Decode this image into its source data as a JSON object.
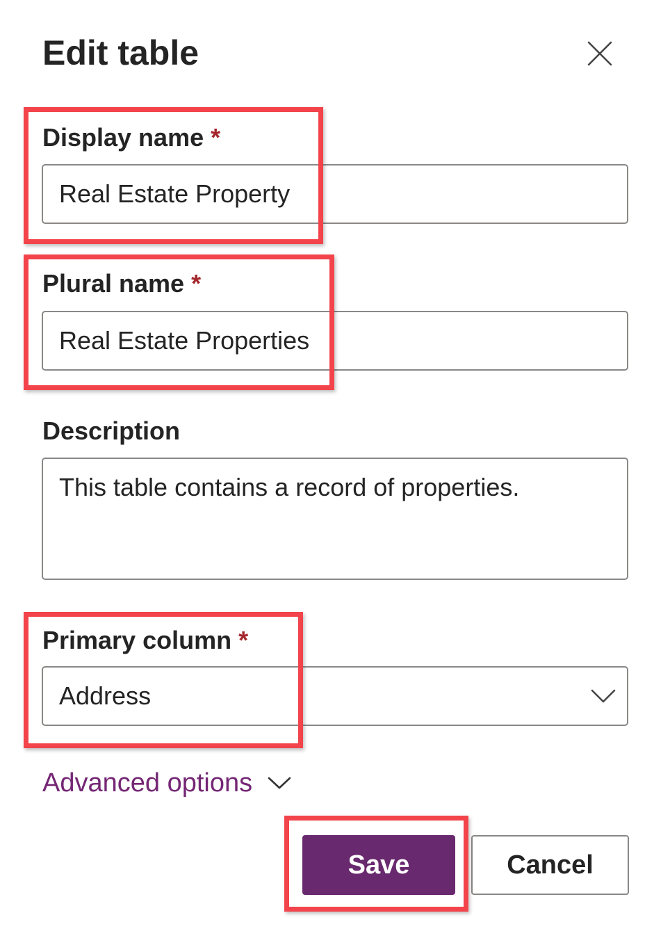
{
  "panel": {
    "title": "Edit table",
    "close_icon": "close-icon"
  },
  "display_name": {
    "label": "Display name",
    "required_marker": "*",
    "value": "Real Estate Property"
  },
  "plural_name": {
    "label": "Plural name",
    "required_marker": "*",
    "value": "Real Estate Properties"
  },
  "description": {
    "label": "Description",
    "value": "This table contains a record of properties."
  },
  "primary_column": {
    "label": "Primary column",
    "required_marker": "*",
    "value": "Address",
    "icon": "chevron-down-icon"
  },
  "advanced": {
    "label": "Advanced options",
    "icon": "chevron-down-icon"
  },
  "actions": {
    "save_label": "Save",
    "cancel_label": "Cancel"
  },
  "colors": {
    "accent": "#742774",
    "primary_button": "#69296e",
    "required": "#a4262c",
    "highlight": "#f2444a",
    "border": "#8a8886"
  }
}
